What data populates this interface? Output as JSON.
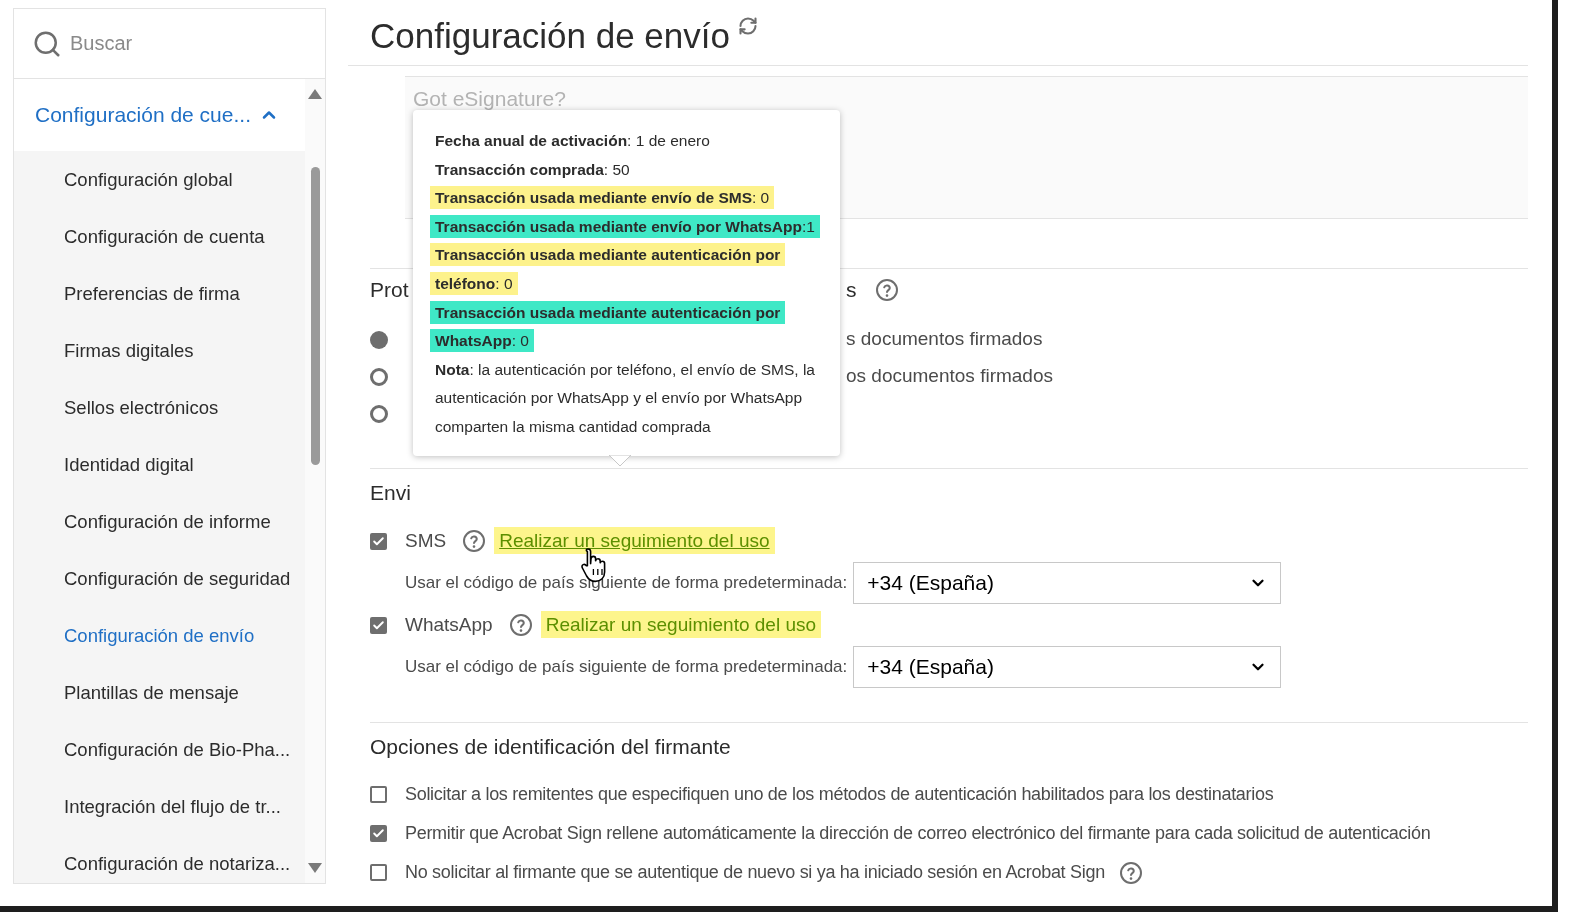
{
  "search": {
    "placeholder": "Buscar"
  },
  "sidebar": {
    "group": {
      "label": "Configuración de cue...",
      "expanded": true
    },
    "items": [
      {
        "label": "Configuración global",
        "selected": false
      },
      {
        "label": "Configuración de cuenta",
        "selected": false
      },
      {
        "label": "Preferencias de firma",
        "selected": false
      },
      {
        "label": "Firmas digitales",
        "selected": false
      },
      {
        "label": "Sellos electrónicos",
        "selected": false
      },
      {
        "label": "Identidad digital",
        "selected": false
      },
      {
        "label": "Configuración de informe",
        "selected": false
      },
      {
        "label": "Configuración de seguridad",
        "selected": false
      },
      {
        "label": "Configuración de envío",
        "selected": true
      },
      {
        "label": "Plantillas de mensaje",
        "selected": false
      },
      {
        "label": "Configuración de Bio-Pha...",
        "selected": false
      },
      {
        "label": "Integración del flujo de tr...",
        "selected": false
      },
      {
        "label": "Configuración de notariza...",
        "selected": false
      }
    ]
  },
  "page_title": "Configuración de envío",
  "message_box": {
    "placeholder": "Got eSignature?"
  },
  "protection_section": {
    "heading_start": "Prot",
    "heading_end": "s",
    "options": [
      {
        "text_end": "s documentos firmados",
        "selected": true
      },
      {
        "text_end": "os documentos firmados",
        "selected": false
      },
      {
        "selected": false
      }
    ]
  },
  "send_section": {
    "heading": "Envi",
    "channels": [
      {
        "label": "SMS",
        "checked": true,
        "track_link": "Realizar un seguimiento del uso",
        "hovered": true,
        "country_label": "Usar el código de país siguiente de forma predeterminada:",
        "country": "+34 (España)"
      },
      {
        "label": "WhatsApp",
        "checked": true,
        "track_link": "Realizar un seguimiento del uso",
        "hovered": false,
        "country_label": "Usar el código de país siguiente de forma predeterminada:",
        "country": "+34 (España)"
      }
    ]
  },
  "tooltip": {
    "lines": [
      {
        "text": "**Fecha anual de activación**: 1 de enero"
      },
      {
        "text": "**Transacción comprada**: 50"
      },
      {
        "text": "**Transacción usada mediante envío de SMS**: 0",
        "color": "#fdf28c"
      },
      {
        "text": "**Transacción usada mediante envío por WhatsApp**:1",
        "color": "#3fe8c6"
      },
      {
        "text": "**Transacción usada mediante autenticación por teléfono**: 0",
        "color": "#fdf28c"
      },
      {
        "text": "**Transacción usada mediante autenticación por WhatsApp**: 0",
        "color": "#3fe8c6"
      }
    ],
    "note": "**Nota**: la autenticación por teléfono, el envío de SMS, la autenticación por WhatsApp y el envío por WhatsApp comparten la misma cantidad comprada"
  },
  "signer_section": {
    "heading": "Opciones de identificación del firmante",
    "options": [
      {
        "label": "Solicitar a los remitentes que especifiquen uno de los métodos de autenticación habilitados para los destinatarios",
        "checked": false,
        "help": false
      },
      {
        "label": "Permitir que Acrobat Sign rellene automáticamente la dirección de correo electrónico del firmante para cada solicitud de autenticación",
        "checked": true,
        "help": false
      },
      {
        "label": "No solicitar al firmante que se autentique de nuevo si ya ha iniciado sesión en Acrobat Sign",
        "checked": false,
        "help": true
      }
    ]
  }
}
